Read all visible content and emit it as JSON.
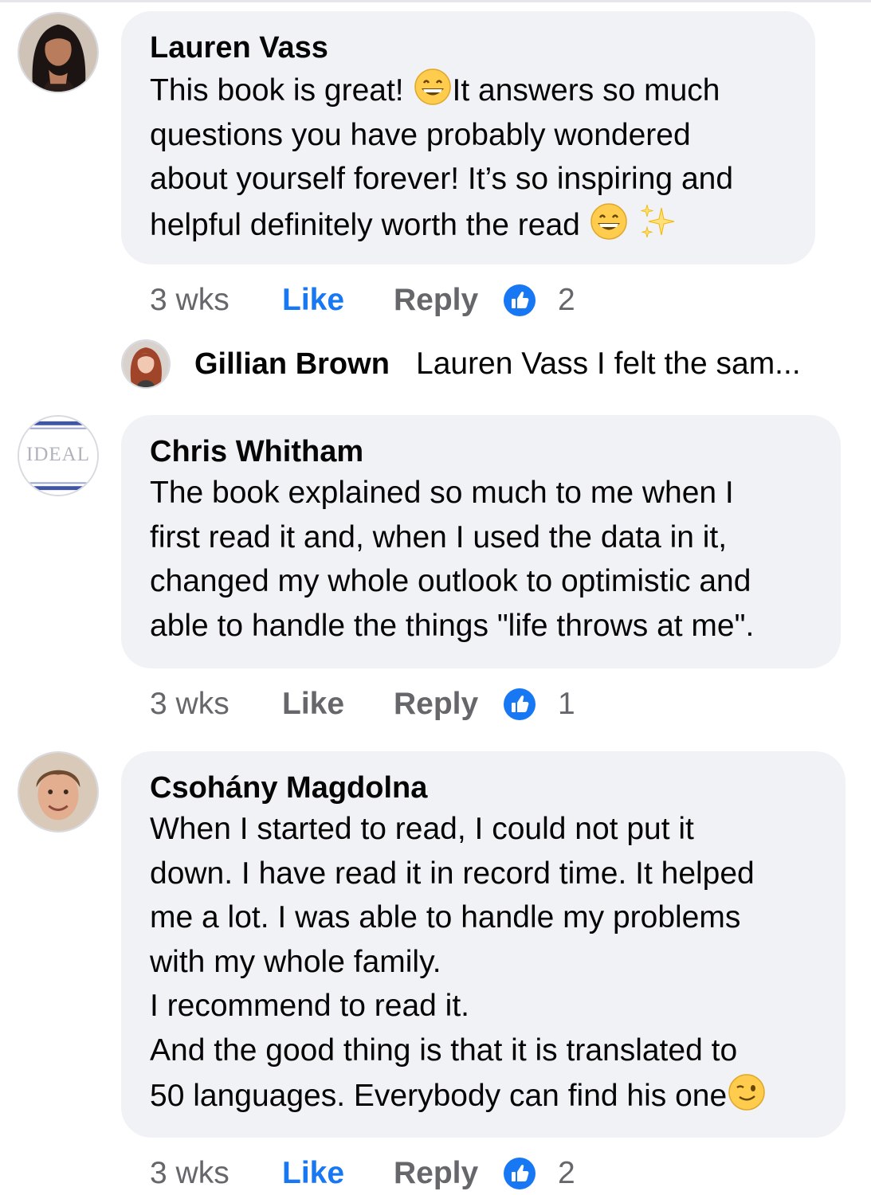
{
  "comments": [
    {
      "author": "Lauren Vass",
      "avatar_icon": "woman-portrait-avatar",
      "lines": [
        "This book is great!",
        "It answers so much",
        "questions you have probably wondered",
        "about yourself forever! It’s so inspiring and",
        "helpful definitely worth the read"
      ],
      "time": "3 wks",
      "like_label": "Like",
      "like_active": true,
      "reply_label": "Reply",
      "reaction_icon": "thumbs-up-icon",
      "reaction_count": "2",
      "replies": [
        {
          "author": "Gillian Brown",
          "avatar_icon": "red-hair-woman-avatar",
          "preview": "Lauren Vass I felt the sam..."
        }
      ]
    },
    {
      "author": "Chris Whitham",
      "avatar_icon": "ideal-logo-avatar",
      "avatar_logo_text": "IDEAL",
      "lines": [
        "The book explained so much to me when I",
        "first read it and, when I used the data in it,",
        "changed my whole outlook to optimistic and",
        "able to handle the things \"life throws at me\"."
      ],
      "time": "3 wks",
      "like_label": "Like",
      "like_active": false,
      "reply_label": "Reply",
      "reaction_icon": "thumbs-up-icon",
      "reaction_count": "1"
    },
    {
      "author": "Csohány Magdolna",
      "avatar_icon": "woman-short-hair-avatar",
      "lines": [
        "When I started to read, I could not put it",
        "down. I have read it in record time. It helped",
        "me a lot. I was able to handle my problems",
        "with my whole family.",
        "I recommend to read it.",
        "And the good thing is that it is translated to",
        "50 languages. Everybody can find his one"
      ],
      "time": "3 wks",
      "like_label": "Like",
      "like_active": true,
      "reply_label": "Reply",
      "reaction_icon": "thumbs-up-icon",
      "reaction_count": "2"
    }
  ],
  "colors": {
    "bubble": "#f0f2f5",
    "like_active": "#1877f2",
    "meta_text": "#65676b",
    "text": "#050505"
  }
}
